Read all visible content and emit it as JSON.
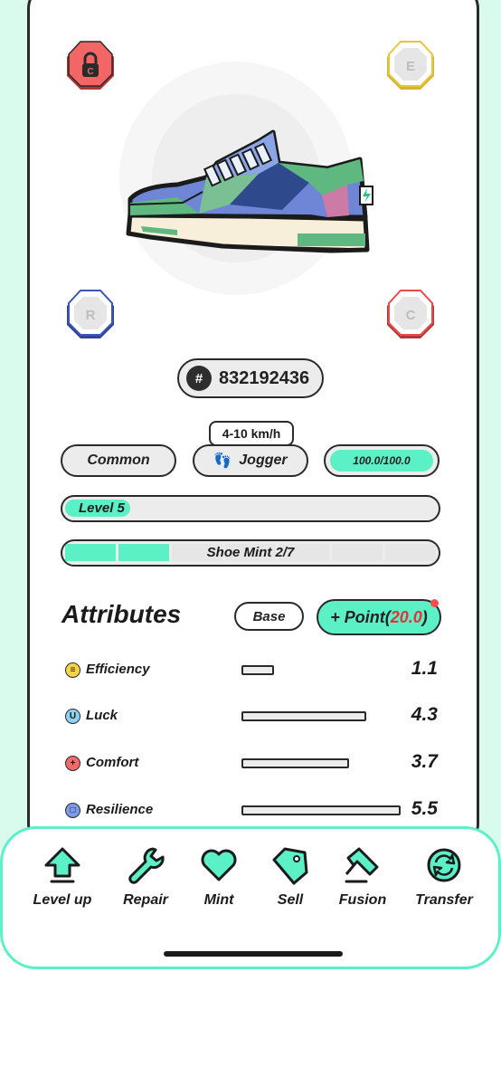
{
  "colors": {
    "accent": "#5cf0c6",
    "background_top": "#d9fbee",
    "border": "#2a2a2a",
    "red": "#e0333a"
  },
  "gems": [
    {
      "letter": "C",
      "locked": true,
      "color": "#e94b4b",
      "icon": "lock-icon"
    },
    {
      "letter": "E",
      "locked": false,
      "color": "#e9c53a",
      "icon": "gem-socket-icon"
    },
    {
      "letter": "R",
      "locked": false,
      "color": "#3b56b3",
      "icon": "gem-socket-icon"
    },
    {
      "letter": "C",
      "locked": false,
      "color": "#e94b4b",
      "icon": "gem-socket-icon"
    }
  ],
  "shoe": {
    "id_symbol": "#",
    "id": "832192436"
  },
  "info": {
    "speed_range": "4-10 km/h",
    "rarity": "Common",
    "type": "Jogger",
    "durability": "100.0/100.0",
    "durability_fraction": 1.0
  },
  "level": {
    "label": "Level 5",
    "level": 5
  },
  "mint": {
    "label": "Shoe Mint 2/7",
    "count": 2,
    "max": 7
  },
  "attributes": {
    "title": "Attributes",
    "base_label": "Base",
    "point_prefix": "+ Point(",
    "point_value": "20.0",
    "point_suffix": ")",
    "items": [
      {
        "name": "Efficiency",
        "value": "1.1",
        "icon": "efficiency-icon"
      },
      {
        "name": "Luck",
        "value": "4.3",
        "icon": "luck-icon"
      },
      {
        "name": "Comfort",
        "value": "3.7",
        "icon": "comfort-icon"
      },
      {
        "name": "Resilience",
        "value": "5.5",
        "icon": "resilience-icon"
      }
    ]
  },
  "actions": [
    {
      "label": "Level up",
      "icon": "level-up-arrow-icon"
    },
    {
      "label": "Repair",
      "icon": "wrench-icon"
    },
    {
      "label": "Mint",
      "icon": "heart-icon"
    },
    {
      "label": "Sell",
      "icon": "price-tag-icon"
    },
    {
      "label": "Fusion",
      "icon": "hammer-icon"
    },
    {
      "label": "Transfer",
      "icon": "transfer-arrows-icon"
    }
  ]
}
